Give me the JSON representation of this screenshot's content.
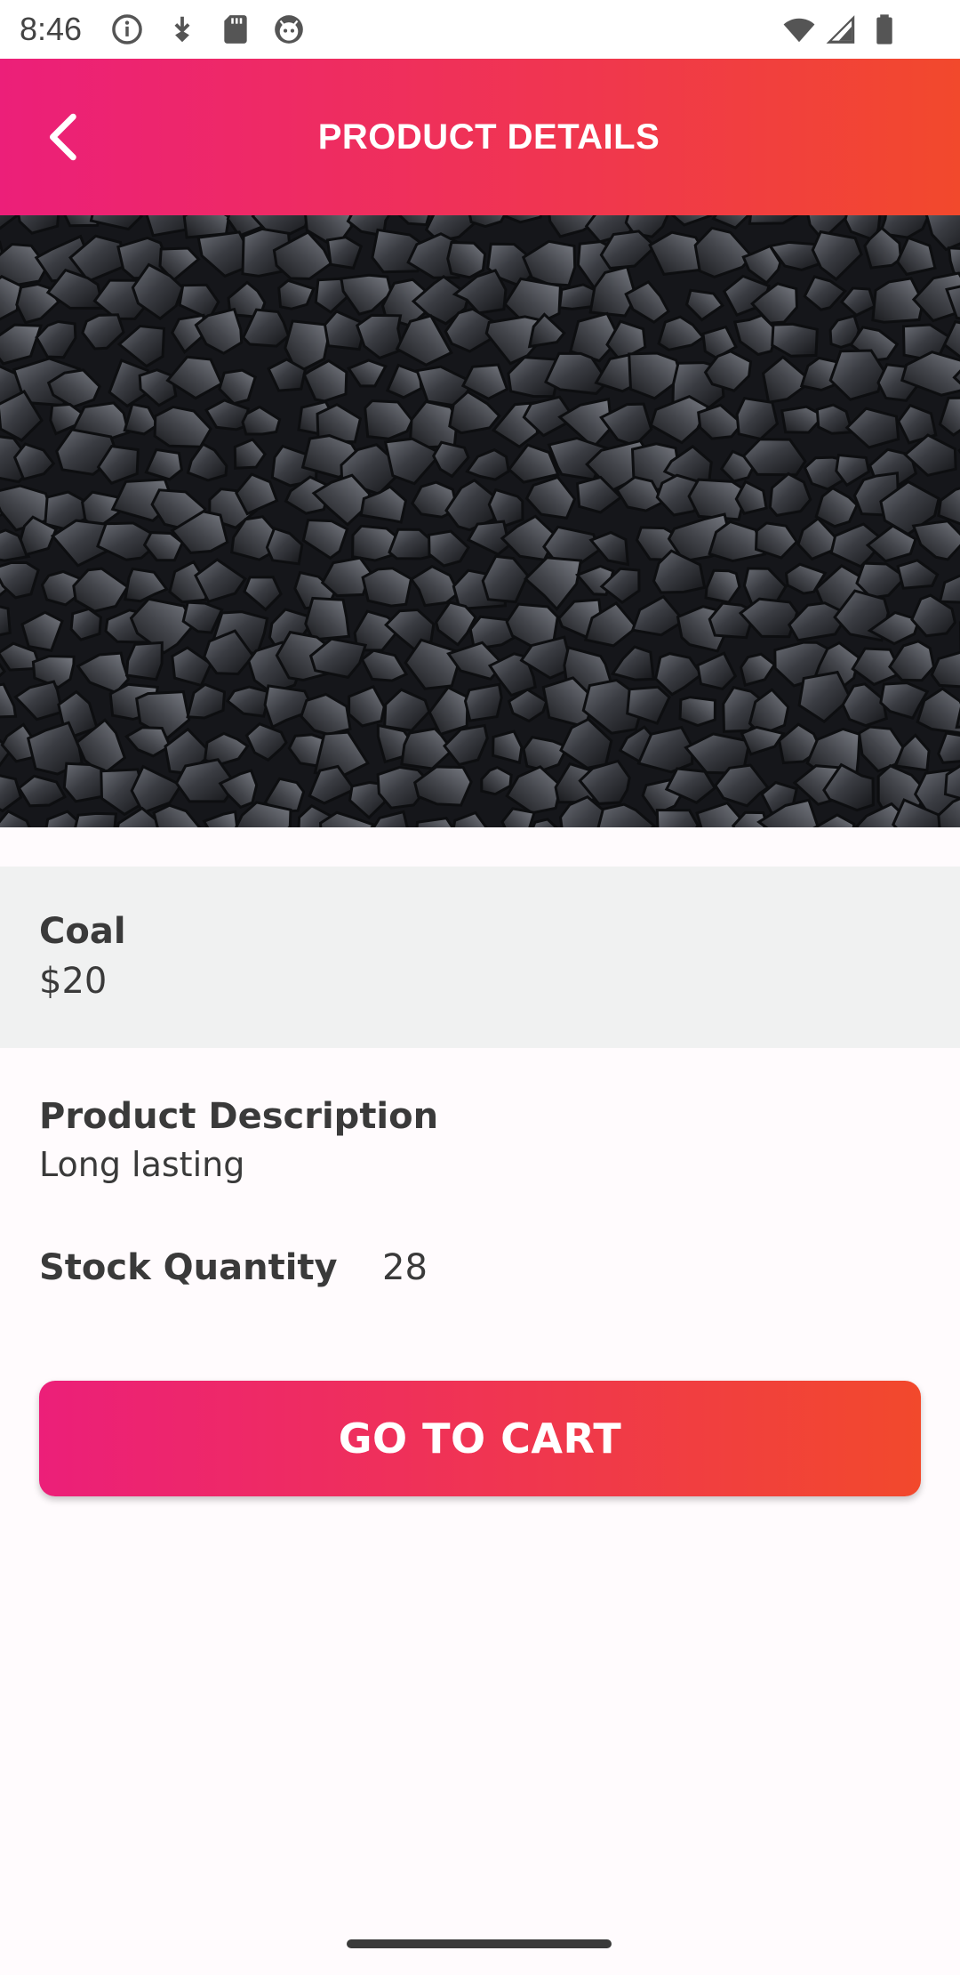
{
  "status_bar": {
    "time": "8:46",
    "icons": [
      "info-icon",
      "download-icon",
      "sd-card-icon",
      "android-face-icon",
      "wifi-icon",
      "signal-icon",
      "battery-icon"
    ]
  },
  "app_bar": {
    "title": "PRODUCT DETAILS",
    "back_icon": "chevron-left-icon",
    "gradient": [
      "#ec1f79",
      "#f2492c"
    ]
  },
  "product": {
    "name": "Coal",
    "price": "$20",
    "description_heading": "Product Description",
    "description": "Long lasting",
    "stock_label": "Stock Quantity",
    "stock_value": "28"
  },
  "actions": {
    "go_to_cart": "GO TO CART"
  }
}
